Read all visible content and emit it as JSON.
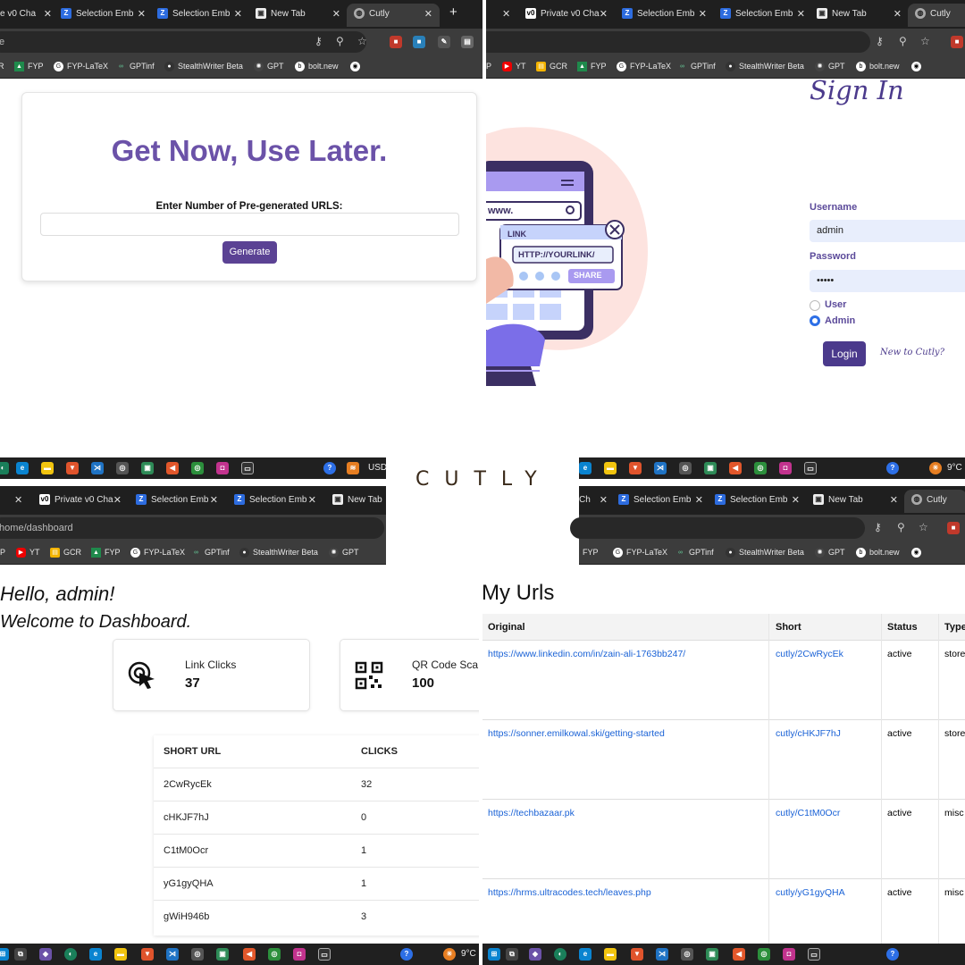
{
  "brand": "CUTLY",
  "q1": {
    "tabs": [
      "e v0 Cha",
      "Selection Emb",
      "Selection Emb",
      "New Tab",
      "Cutly"
    ],
    "url": "te",
    "bookmarks": [
      "R",
      "FYP",
      "FYP-LaTeX",
      "GPTinf",
      "StealthWriter Beta",
      "GPT",
      "bolt.new"
    ],
    "heading": "Get Now, Use Later.",
    "label": "Enter Number of Pre-generated URLS:",
    "button": "Generate",
    "taskbar_text": "USD"
  },
  "q2": {
    "tabs": [
      "Private v0 Cha",
      "Selection Emb",
      "Selection Emb",
      "New Tab",
      "Cutly"
    ],
    "bookmarks": [
      "P",
      "YT",
      "GCR",
      "FYP",
      "FYP-LaTeX",
      "GPTinf",
      "StealthWriter Beta",
      "GPT",
      "bolt.new"
    ],
    "illustration": {
      "www": "www.",
      "link": "LINK",
      "http": "HTTP://YOURLINK/",
      "share": "SHARE"
    },
    "title": "Sign In",
    "username_label": "Username",
    "username_value": "admin",
    "password_label": "Password",
    "password_value": "•••••",
    "role_user": "User",
    "role_admin": "Admin",
    "selected_role": "Admin",
    "login": "Login",
    "new_to": "New to Cutly?",
    "temp": "9°C"
  },
  "q3": {
    "tabs": [
      "Private v0 Cha",
      "Selection Emb",
      "Selection Emb",
      "New Tab"
    ],
    "url": "/home/dashboard",
    "bookmarks": [
      "P",
      "YT",
      "GCR",
      "FYP",
      "FYP-LaTeX",
      "GPTinf",
      "StealthWriter Beta",
      "GPT"
    ],
    "hello": "Hello, admin!",
    "welcome": "Welcome to Dashboard.",
    "stats": [
      {
        "label": "Link Clicks",
        "value": "37"
      },
      {
        "label": "QR Code Sca",
        "value": "100"
      }
    ],
    "table_headers": [
      "SHORT URL",
      "CLICKS"
    ],
    "rows": [
      {
        "short": "2CwRycEk",
        "clicks": "32"
      },
      {
        "short": "cHKJF7hJ",
        "clicks": "0"
      },
      {
        "short": "C1tM0Ocr",
        "clicks": "1"
      },
      {
        "short": "yG1gyQHA",
        "clicks": "1"
      },
      {
        "short": "gWiH946b",
        "clicks": "3"
      }
    ],
    "temp": "9°C"
  },
  "q4": {
    "tabs": [
      "Ch",
      "Selection Emb",
      "Selection Emb",
      "New Tab",
      "Cutly"
    ],
    "bookmarks": [
      "FYP",
      "FYP-LaTeX",
      "GPTinf",
      "StealthWriter Beta",
      "GPT",
      "bolt.new"
    ],
    "title": "My Urls",
    "headers": [
      "Original",
      "Short",
      "Status",
      "Type"
    ],
    "rows": [
      {
        "original": "https://www.linkedin.com/in/zain-ali-1763bb247/",
        "short": "cutly/2CwRycEk",
        "status": "active",
        "type": "store"
      },
      {
        "original": "https://sonner.emilkowal.ski/getting-started",
        "short": "cutly/cHKJF7hJ",
        "status": "active",
        "type": "store"
      },
      {
        "original": "https://techbazaar.pk",
        "short": "cutly/C1tM0Ocr",
        "status": "active",
        "type": "misc"
      },
      {
        "original": "https://hrms.ultracodes.tech/leaves.php",
        "short": "cutly/yG1gyQHA",
        "status": "active",
        "type": "misc"
      }
    ]
  }
}
